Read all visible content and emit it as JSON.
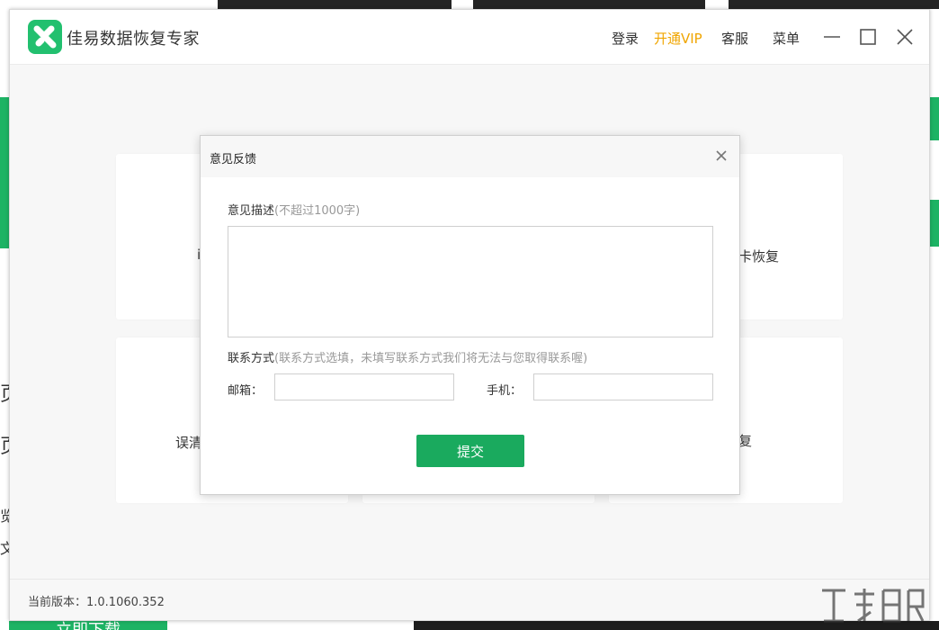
{
  "app": {
    "title": "佳易数据恢复专家",
    "version_label": "当前版本：1.0.1060.352"
  },
  "titlebar": {
    "login": "登录",
    "vip": "开通VIP",
    "service": "客服",
    "menu": "菜单"
  },
  "cards": [
    {
      "label": "i"
    },
    {
      "label": "卡恢复"
    },
    {
      "label": "误清"
    },
    {
      "label": "复"
    }
  ],
  "dialog": {
    "title": "意见反馈",
    "desc_label": "意见描述",
    "desc_hint": "(不超过1000字)",
    "desc_value": "",
    "contact_label": "联系方式",
    "contact_hint": "(联系方式选填，未填写联系方式我们将无法与您取得联系喔)",
    "email_label": "邮箱：",
    "email_value": "",
    "phone_label": "手机：",
    "phone_value": "",
    "submit_label": "提交"
  },
  "background": {
    "left_fragments": [
      "页",
      "页",
      "览",
      "文"
    ],
    "download_label": "立即下载"
  },
  "colors": {
    "accent_green": "#1aaa5e",
    "vip_orange": "#f0a500"
  }
}
